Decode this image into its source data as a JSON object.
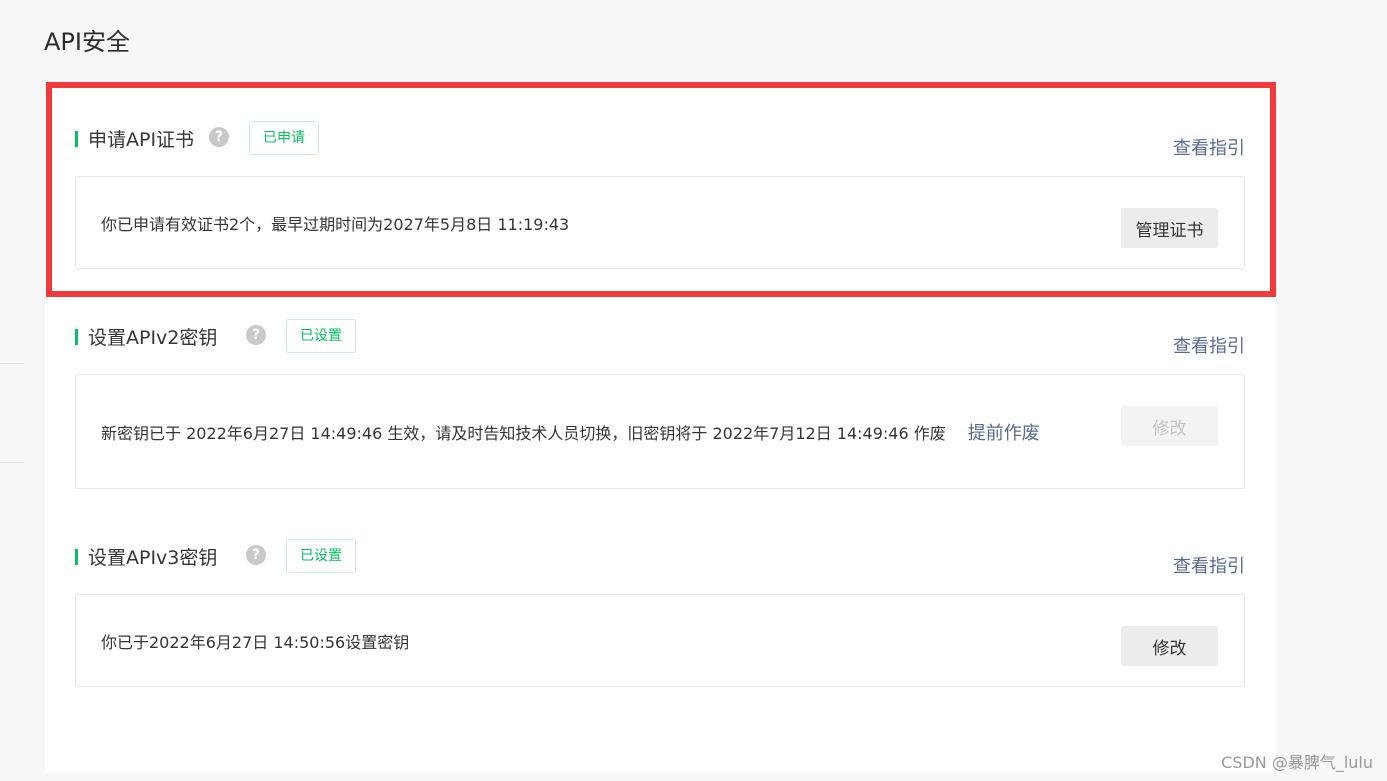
{
  "page": {
    "title": "API安全"
  },
  "sections": [
    {
      "title": "申请API证书",
      "help_icon": "question-mark-icon",
      "status": "已申请",
      "guide_link": "查看指引",
      "description": "你已申请有效证书2个，最早过期时间为2027年5月8日 11:19:43",
      "action": "管理证书",
      "action_disabled": false
    },
    {
      "title": "设置APIv2密钥",
      "help_icon": "question-mark-icon",
      "status": "已设置",
      "guide_link": "查看指引",
      "description": "新密钥已于 2022年6月27日 14:49:46 生效，请及时告知技术人员切换，旧密钥将于 2022年7月12日 14:49:46 作废",
      "inline_link": "提前作废",
      "action": "修改",
      "action_disabled": true
    },
    {
      "title": "设置APIv3密钥",
      "help_icon": "question-mark-icon",
      "status": "已设置",
      "guide_link": "查看指引",
      "description": "你已于2022年6月27日 14:50:56设置密钥",
      "action": "修改",
      "action_disabled": false
    }
  ],
  "colors": {
    "accent_green": "#07c160",
    "link_blue": "#576b95",
    "highlight_red": "#f23a3c"
  },
  "watermark": "CSDN @暴脾气_lulu"
}
